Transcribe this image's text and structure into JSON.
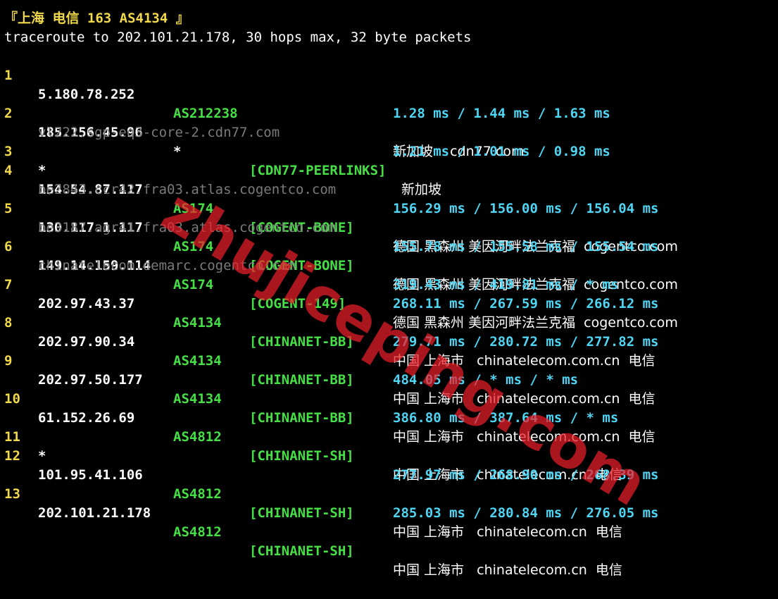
{
  "header": {
    "title": "『上海 电信 163 AS4134 』",
    "command": "traceroute to 202.101.21.178, 30 hops max, 32 byte packets"
  },
  "hops": [
    {
      "hop": "1",
      "ip": "5.180.78.252",
      "asn": "AS212238",
      "tag": "",
      "geo": "新加坡    cdn77.com",
      "host": "",
      "rtt": "1.28 ms / 1.44 ms / 1.63 ms"
    },
    {
      "hop": "2",
      "ip": "185.156.45.96",
      "asn": "*",
      "tag": "[CDN77-PEERLINKS]",
      "geo": "新加坡",
      "host": "vl222.sgp-eq3-core-2.cdn77.com",
      "rtt": "1.21 ms / 1.01 ms / 0.98 ms"
    },
    {
      "hop": "3",
      "ip": "*",
      "asn": "",
      "tag": "",
      "geo": "",
      "host": "",
      "rtt": ""
    },
    {
      "hop": "4",
      "ip": "154.54.87.117",
      "asn": "AS174",
      "tag": "[COGENT-BONE]",
      "geo": "德国 黑森州 美因河畔法兰克福  cogentco.com",
      "host": "be2843.ccr42.fra03.atlas.cogentco.com",
      "rtt": "156.29 ms / 156.00 ms / 156.04 ms"
    },
    {
      "hop": "5",
      "ip": "130.117.1.117",
      "asn": "AS174",
      "tag": "[COGENT-BONE]",
      "geo": "德国 黑森州 美因河畔法兰克福  cogentco.com",
      "host": "be3187.agr41.fra03.atlas.cogentco.com",
      "rtt": "155.78 ms / 155.58 ms / 155.54 ms"
    },
    {
      "hop": "6",
      "ip": "149.14.159.114",
      "asn": "AS174",
      "tag": "[COGENT-149]",
      "geo": "德国 黑森州 美因河畔法兰克福  cogentco.com",
      "host": "chinatelecom.demarc.cogentco.com",
      "rtt": "319.43 ms / 419.81 ms / * ms"
    },
    {
      "hop": "7",
      "ip": "202.97.43.37",
      "asn": "AS4134",
      "tag": "[CHINANET-BB]",
      "geo": "中国 上海市   chinatelecom.com.cn  电信",
      "host": "",
      "rtt": "268.11 ms / 267.59 ms / 266.12 ms"
    },
    {
      "hop": "8",
      "ip": "202.97.90.34",
      "asn": "AS4134",
      "tag": "[CHINANET-BB]",
      "geo": "中国 上海市   chinatelecom.com.cn  电信",
      "host": "",
      "rtt": "279.71 ms / 280.72 ms / 277.82 ms"
    },
    {
      "hop": "9",
      "ip": "202.97.50.177",
      "asn": "AS4134",
      "tag": "[CHINANET-BB]",
      "geo": "中国 上海市   chinatelecom.com.cn  电信",
      "host": "",
      "rtt": "484.05 ms / * ms / * ms"
    },
    {
      "hop": "10",
      "ip": "61.152.26.69",
      "asn": "AS4812",
      "tag": "[CHINANET-SH]",
      "geo": "中国 上海市   chinatelecom.cn  电信",
      "host": "",
      "rtt": "386.80 ms / 387.64 ms / * ms"
    },
    {
      "hop": "11",
      "ip": "*",
      "asn": "",
      "tag": "",
      "geo": "",
      "host": "",
      "rtt": ""
    },
    {
      "hop": "12",
      "ip": "101.95.41.106",
      "asn": "AS4812",
      "tag": "[CHINANET-SH]",
      "geo": "中国 上海市   chinatelecom.cn  电信",
      "host": "",
      "rtt": "277.97 ms / 268.90 ms / 268.39 ms"
    },
    {
      "hop": "13",
      "ip": "202.101.21.178",
      "asn": "AS4812",
      "tag": "[CHINANET-SH]",
      "geo": "中国 上海市   chinatelecom.cn  电信",
      "host": "",
      "rtt": "285.03 ms / 280.84 ms / 276.05 ms"
    }
  ],
  "watermark": "zhujiceping.com",
  "colors": {
    "background": "#000000",
    "hop_number": "#f2d94a",
    "ip": "#ffffff",
    "asn": "#46e046",
    "tag": "#46e046",
    "rtt": "#4fd6f5",
    "hostname": "#7b7b7b",
    "watermark": "#eb1e28"
  }
}
